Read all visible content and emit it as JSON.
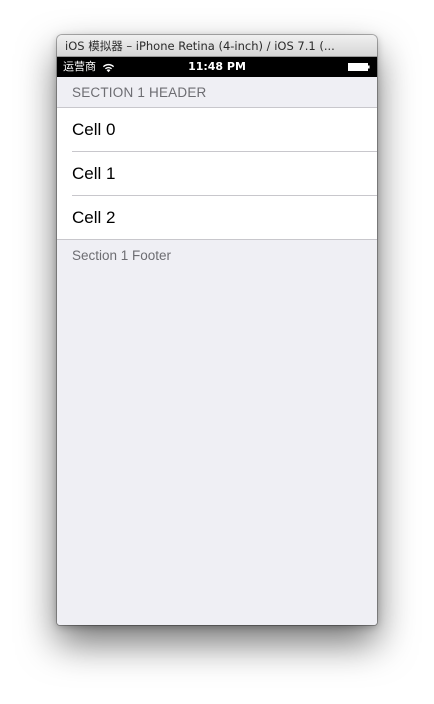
{
  "window": {
    "title": "iOS 模拟器 – iPhone Retina (4-inch) / iOS 7.1 (..."
  },
  "status_bar": {
    "carrier": "运营商",
    "time": "11:48 PM",
    "wifi_icon": "wifi-icon",
    "battery_icon": "battery-full-icon"
  },
  "table": {
    "section_header": "SECTION 1 HEADER",
    "cells": [
      {
        "label": "Cell 0"
      },
      {
        "label": "Cell 1"
      },
      {
        "label": "Cell 2"
      }
    ],
    "section_footer": "Section 1 Footer"
  },
  "colors": {
    "background": "#efeff4",
    "cell_background": "#ffffff",
    "separator": "#c8c7cc",
    "header_text": "#6d6d72",
    "status_bar": "#000000"
  }
}
